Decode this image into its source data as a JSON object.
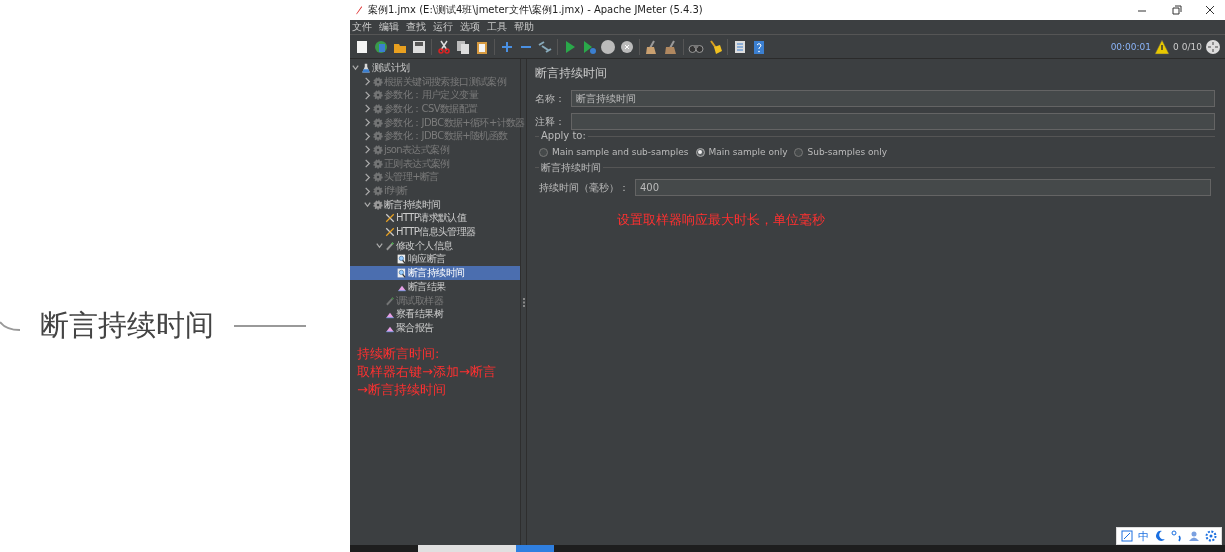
{
  "mindmap_node": {
    "label": "断言持续时间"
  },
  "window": {
    "title": "案例1.jmx (E:\\测试4班\\jmeter文件\\案例1.jmx) - Apache JMeter (5.4.3)"
  },
  "menu": [
    "文件",
    "编辑",
    "查找",
    "运行",
    "选项",
    "工具",
    "帮助"
  ],
  "status": {
    "elapsed": "00:00:01",
    "warnings": "0",
    "threads": "0/10"
  },
  "tree": [
    {
      "label": "测试计划",
      "kind": "plan",
      "disabled": false,
      "expanded": true,
      "selected": false,
      "children": [
        {
          "label": "根据关键词搜索接口测试案例",
          "kind": "threadgroup",
          "disabled": true,
          "expanded": false,
          "selected": false
        },
        {
          "label": "参数化：用户定义变量",
          "kind": "threadgroup",
          "disabled": true,
          "expanded": false,
          "selected": false
        },
        {
          "label": "参数化：CSV数据配置",
          "kind": "threadgroup",
          "disabled": true,
          "expanded": false,
          "selected": false
        },
        {
          "label": "参数化：JDBC数据+循环+计数器",
          "kind": "threadgroup",
          "disabled": true,
          "expanded": false,
          "selected": false
        },
        {
          "label": "参数化：JDBC数据+随机函数",
          "kind": "threadgroup",
          "disabled": true,
          "expanded": false,
          "selected": false
        },
        {
          "label": "json表达式案例",
          "kind": "threadgroup",
          "disabled": true,
          "expanded": false,
          "selected": false
        },
        {
          "label": "正则表达式案例",
          "kind": "threadgroup",
          "disabled": true,
          "expanded": false,
          "selected": false
        },
        {
          "label": "头管理+断言",
          "kind": "threadgroup",
          "disabled": true,
          "expanded": false,
          "selected": false
        },
        {
          "label": "if判断",
          "kind": "threadgroup",
          "disabled": true,
          "expanded": false,
          "selected": false
        },
        {
          "label": "断言持续时间",
          "kind": "threadgroup",
          "disabled": false,
          "expanded": true,
          "selected": false,
          "children": [
            {
              "label": "HTTP请求默认值",
              "kind": "config",
              "disabled": false,
              "selected": false
            },
            {
              "label": "HTTP信息头管理器",
              "kind": "config",
              "disabled": false,
              "selected": false
            },
            {
              "label": "修改个人信息",
              "kind": "sampler",
              "disabled": false,
              "expanded": true,
              "selected": false,
              "children": [
                {
                  "label": "响应断言",
                  "kind": "assertion",
                  "disabled": false,
                  "selected": false
                },
                {
                  "label": "断言持续时间",
                  "kind": "assertion",
                  "disabled": false,
                  "selected": true
                },
                {
                  "label": "断言结果",
                  "kind": "listener",
                  "disabled": false,
                  "selected": false
                }
              ]
            },
            {
              "label": "调试取样器",
              "kind": "sampler",
              "disabled": true,
              "selected": false
            },
            {
              "label": "察看结果树",
              "kind": "listener",
              "disabled": false,
              "selected": false
            },
            {
              "label": "聚合报告",
              "kind": "listener",
              "disabled": false,
              "selected": false
            }
          ]
        }
      ]
    }
  ],
  "tree_note": [
    "持续断言时间:",
    "取样器右键→添加→断言",
    "→断言持续时间"
  ],
  "editor": {
    "title": "断言持续时间",
    "name_label": "名称：",
    "name_value": "断言持续时间",
    "comment_label": "注释：",
    "apply_to": {
      "legend": "Apply to:",
      "options": [
        {
          "label": "Main sample and sub-samples",
          "selected": false
        },
        {
          "label": "Main sample only",
          "selected": true
        },
        {
          "label": "Sub-samples only",
          "selected": false
        }
      ]
    },
    "section": "断言持续时间",
    "duration_label": "持续时间（毫秒）：",
    "duration_value": "400",
    "note": "设置取样器响应最大时长，单位毫秒"
  },
  "ime": {
    "mode": "中"
  }
}
